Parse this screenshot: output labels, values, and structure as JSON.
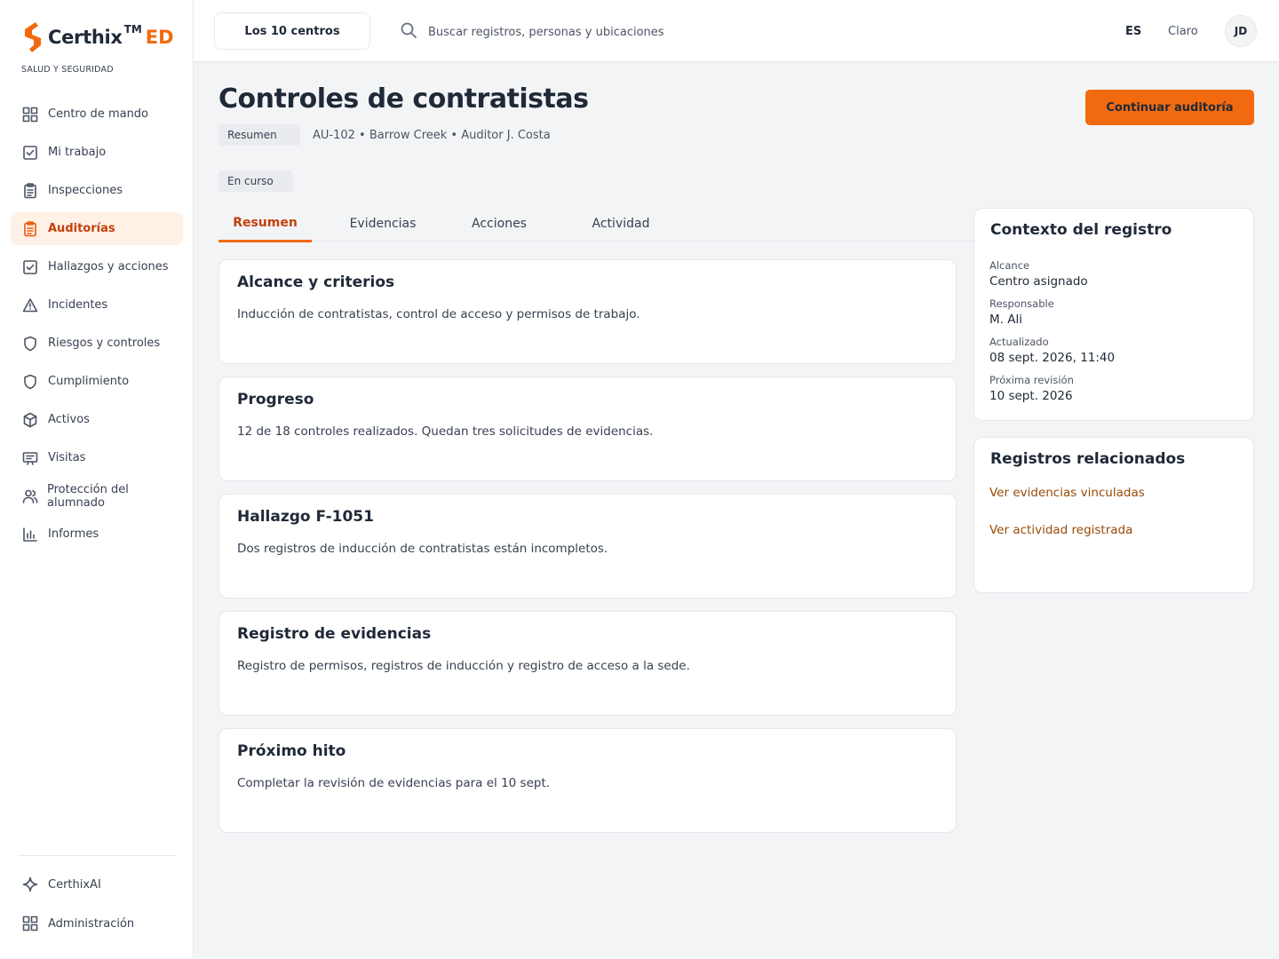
{
  "brand": {
    "name": "Certhix",
    "tm": "TM",
    "suffix": "ED",
    "subtitle": "SALUD Y SEGURIDAD",
    "accent": "#f26a0f"
  },
  "sidebar": {
    "items": [
      {
        "label": "Centro de mando",
        "icon": "grid-icon",
        "active": false
      },
      {
        "label": "Mi trabajo",
        "icon": "check-square-icon",
        "active": false
      },
      {
        "label": "Inspecciones",
        "icon": "clipboard-icon",
        "active": false
      },
      {
        "label": "Auditorías",
        "icon": "clipboard-icon",
        "active": true
      },
      {
        "label": "Hallazgos y acciones",
        "icon": "check-square-icon",
        "active": false
      },
      {
        "label": "Incidentes",
        "icon": "warning-triangle-icon",
        "active": false
      },
      {
        "label": "Riesgos y controles",
        "icon": "shield-icon",
        "active": false
      },
      {
        "label": "Cumplimiento",
        "icon": "shield-icon",
        "active": false
      },
      {
        "label": "Activos",
        "icon": "cube-icon",
        "active": false
      },
      {
        "label": "Visitas",
        "icon": "id-card-icon",
        "active": false
      },
      {
        "label": "Protección del alumnado",
        "icon": "users-icon",
        "active": false
      },
      {
        "label": "Informes",
        "icon": "bar-chart-icon",
        "active": false
      }
    ],
    "bottom": [
      {
        "label": "CerthixAI",
        "icon": "sparkle-icon"
      },
      {
        "label": "Administración",
        "icon": "grid-icon"
      }
    ]
  },
  "topbar": {
    "site_selector": "Los 10 centros",
    "search_placeholder": "Buscar registros, personas y ubicaciones",
    "language": "ES",
    "theme": "Claro",
    "avatar_initials": "JD"
  },
  "header": {
    "title": "Controles de contratistas",
    "summary_chip": "Resumen",
    "meta": "AU-102 • Barrow Creek • Auditor J. Costa",
    "status_chip": "En curso",
    "primary_action": "Continuar auditoría"
  },
  "tabs": [
    {
      "label": "Resumen",
      "active": true
    },
    {
      "label": "Evidencias",
      "active": false
    },
    {
      "label": "Acciones",
      "active": false
    },
    {
      "label": "Actividad",
      "active": false
    }
  ],
  "cards": [
    {
      "title": "Alcance y criterios",
      "body": "Inducción de contratistas, control de acceso y permisos de trabajo."
    },
    {
      "title": "Progreso",
      "body": "12 de 18 controles realizados. Quedan tres solicitudes de evidencias."
    },
    {
      "title": "Hallazgo F-1051",
      "body": "Dos registros de inducción de contratistas están incompletos."
    },
    {
      "title": "Registro de evidencias",
      "body": "Registro de permisos, registros de inducción y registro de acceso a la sede."
    },
    {
      "title": "Próximo hito",
      "body": "Completar la revisión de evidencias para el 10 sept."
    }
  ],
  "context": {
    "title": "Contexto del registro",
    "fields": [
      {
        "label": "Alcance",
        "value": "Centro asignado"
      },
      {
        "label": "Responsable",
        "value": "M. Ali"
      },
      {
        "label": "Actualizado",
        "value": "08 sept. 2026, 11:40"
      },
      {
        "label": "Próxima revisión",
        "value": "10 sept. 2026"
      }
    ]
  },
  "related": {
    "title": "Registros relacionados",
    "links": [
      "Ver evidencias vinculadas",
      "Ver actividad registrada"
    ]
  }
}
